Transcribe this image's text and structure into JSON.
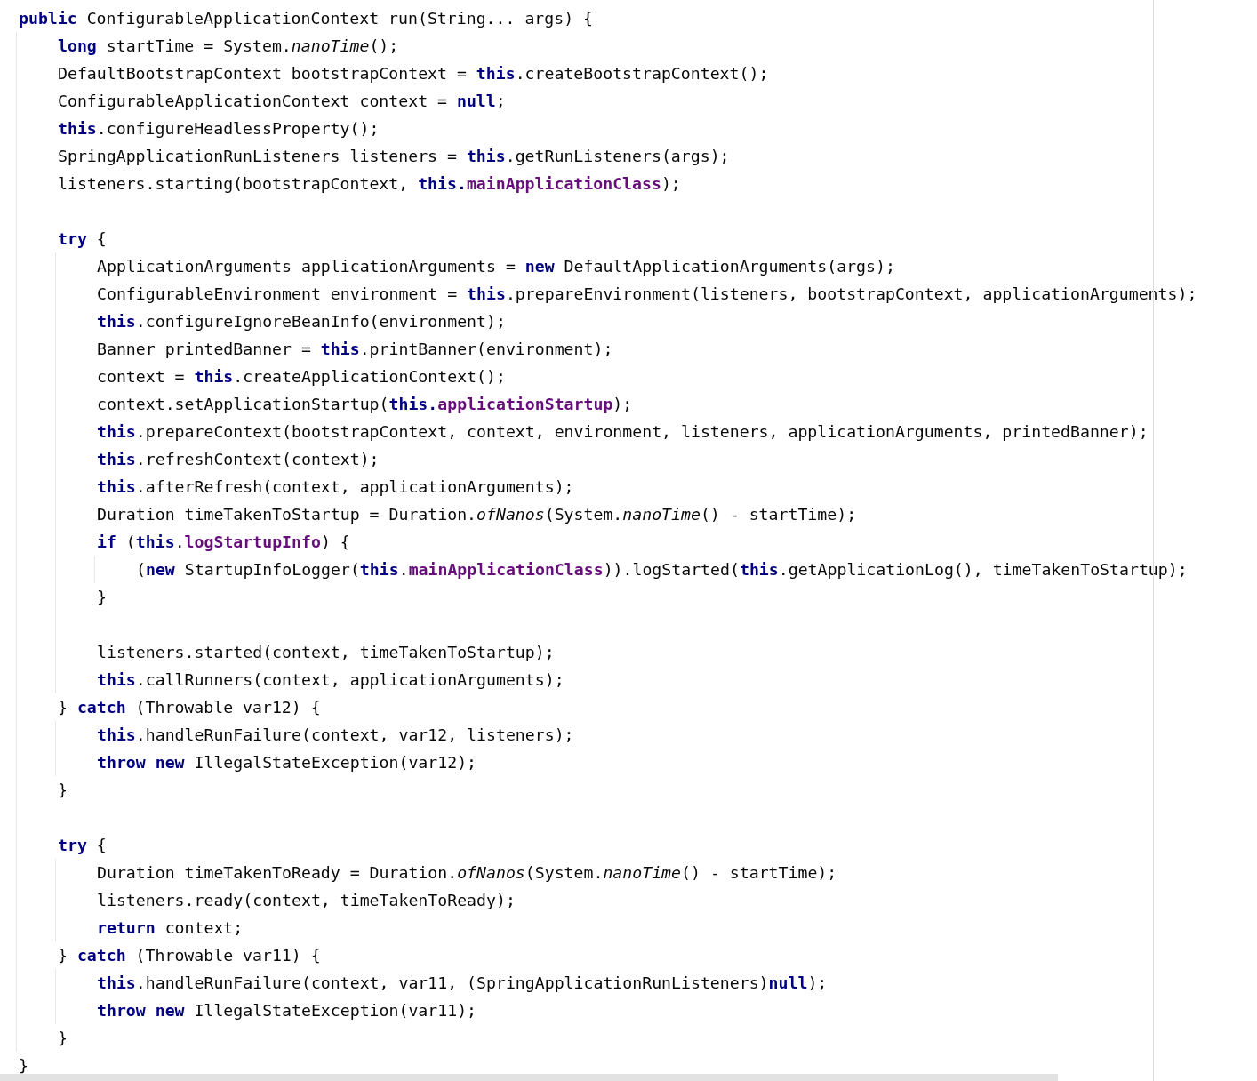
{
  "editor": {
    "lines": [
      {
        "kind": "code",
        "tokens": [
          {
            "kind": "keyword",
            "text": "public"
          },
          {
            "kind": "plain",
            "text": " ConfigurableApplicationContext run(String... args) {"
          }
        ],
        "children": [
          {
            "kind": "code",
            "tokens": [
              {
                "kind": "keyword",
                "text": "long"
              },
              {
                "kind": "plain",
                "text": " startTime = System."
              },
              {
                "kind": "static",
                "text": "nanoTime"
              },
              {
                "kind": "plain",
                "text": "();"
              }
            ]
          },
          {
            "kind": "code",
            "tokens": [
              {
                "kind": "plain",
                "text": "DefaultBootstrapContext bootstrapContext = "
              },
              {
                "kind": "keyword",
                "text": "this"
              },
              {
                "kind": "plain",
                "text": ".createBootstrapContext();"
              }
            ]
          },
          {
            "kind": "code",
            "tokens": [
              {
                "kind": "plain",
                "text": "ConfigurableApplicationContext context = "
              },
              {
                "kind": "keyword",
                "text": "null"
              },
              {
                "kind": "plain",
                "text": ";"
              }
            ]
          },
          {
            "kind": "code",
            "tokens": [
              {
                "kind": "keyword",
                "text": "this"
              },
              {
                "kind": "plain",
                "text": ".configureHeadlessProperty();"
              }
            ]
          },
          {
            "kind": "code",
            "tokens": [
              {
                "kind": "plain",
                "text": "SpringApplicationRunListeners listeners = "
              },
              {
                "kind": "keyword",
                "text": "this"
              },
              {
                "kind": "plain",
                "text": ".getRunListeners(args);"
              }
            ]
          },
          {
            "kind": "code",
            "tokens": [
              {
                "kind": "plain",
                "text": "listeners.starting(bootstrapContext, "
              },
              {
                "kind": "keyword",
                "text": "this."
              },
              {
                "kind": "field",
                "text": "mainApplicationClass"
              },
              {
                "kind": "plain",
                "text": ");"
              }
            ]
          },
          {
            "kind": "blank"
          },
          {
            "kind": "code",
            "tokens": [
              {
                "kind": "keyword",
                "text": "try"
              },
              {
                "kind": "plain",
                "text": " {"
              }
            ],
            "children": [
              {
                "kind": "code",
                "tokens": [
                  {
                    "kind": "plain",
                    "text": "ApplicationArguments applicationArguments = "
                  },
                  {
                    "kind": "keyword",
                    "text": "new"
                  },
                  {
                    "kind": "plain",
                    "text": " DefaultApplicationArguments(args);"
                  }
                ]
              },
              {
                "kind": "code",
                "tokens": [
                  {
                    "kind": "plain",
                    "text": "ConfigurableEnvironment environment = "
                  },
                  {
                    "kind": "keyword",
                    "text": "this"
                  },
                  {
                    "kind": "plain",
                    "text": ".prepareEnvironment(listeners, bootstrapContext, applicationArguments);"
                  }
                ]
              },
              {
                "kind": "code",
                "tokens": [
                  {
                    "kind": "keyword",
                    "text": "this"
                  },
                  {
                    "kind": "plain",
                    "text": ".configureIgnoreBeanInfo(environment);"
                  }
                ]
              },
              {
                "kind": "code",
                "tokens": [
                  {
                    "kind": "plain",
                    "text": "Banner printedBanner = "
                  },
                  {
                    "kind": "keyword",
                    "text": "this"
                  },
                  {
                    "kind": "plain",
                    "text": ".printBanner(environment);"
                  }
                ]
              },
              {
                "kind": "code",
                "tokens": [
                  {
                    "kind": "plain",
                    "text": "context = "
                  },
                  {
                    "kind": "keyword",
                    "text": "this"
                  },
                  {
                    "kind": "plain",
                    "text": ".createApplicationContext();"
                  }
                ]
              },
              {
                "kind": "code",
                "tokens": [
                  {
                    "kind": "plain",
                    "text": "context.setApplicationStartup("
                  },
                  {
                    "kind": "keyword",
                    "text": "this."
                  },
                  {
                    "kind": "field",
                    "text": "applicationStartup"
                  },
                  {
                    "kind": "plain",
                    "text": ");"
                  }
                ]
              },
              {
                "kind": "code",
                "tokens": [
                  {
                    "kind": "keyword",
                    "text": "this"
                  },
                  {
                    "kind": "plain",
                    "text": ".prepareContext(bootstrapContext, context, environment, listeners, applicationArguments, printedBanner);"
                  }
                ]
              },
              {
                "kind": "code",
                "tokens": [
                  {
                    "kind": "keyword",
                    "text": "this"
                  },
                  {
                    "kind": "plain",
                    "text": ".refreshContext(context);"
                  }
                ]
              },
              {
                "kind": "code",
                "tokens": [
                  {
                    "kind": "keyword",
                    "text": "this"
                  },
                  {
                    "kind": "plain",
                    "text": ".afterRefresh(context, applicationArguments);"
                  }
                ]
              },
              {
                "kind": "code",
                "tokens": [
                  {
                    "kind": "plain",
                    "text": "Duration timeTakenToStartup = Duration."
                  },
                  {
                    "kind": "static",
                    "text": "ofNanos"
                  },
                  {
                    "kind": "plain",
                    "text": "(System."
                  },
                  {
                    "kind": "static",
                    "text": "nanoTime"
                  },
                  {
                    "kind": "plain",
                    "text": "() - startTime);"
                  }
                ]
              },
              {
                "kind": "code",
                "tokens": [
                  {
                    "kind": "keyword",
                    "text": "if"
                  },
                  {
                    "kind": "plain",
                    "text": " ("
                  },
                  {
                    "kind": "keyword",
                    "text": "this"
                  },
                  {
                    "kind": "plain",
                    "text": "."
                  },
                  {
                    "kind": "field",
                    "text": "logStartupInfo"
                  },
                  {
                    "kind": "plain",
                    "text": ") {"
                  }
                ],
                "children": [
                  {
                    "kind": "code",
                    "tokens": [
                      {
                        "kind": "plain",
                        "text": "("
                      },
                      {
                        "kind": "keyword",
                        "text": "new"
                      },
                      {
                        "kind": "plain",
                        "text": " StartupInfoLogger("
                      },
                      {
                        "kind": "keyword",
                        "text": "this"
                      },
                      {
                        "kind": "plain",
                        "text": "."
                      },
                      {
                        "kind": "field",
                        "text": "mainApplicationClass"
                      },
                      {
                        "kind": "plain",
                        "text": ")).logStarted("
                      },
                      {
                        "kind": "keyword",
                        "text": "this"
                      },
                      {
                        "kind": "plain",
                        "text": ".getApplicationLog(), timeTakenToStartup);"
                      }
                    ]
                  }
                ]
              },
              {
                "kind": "code",
                "tokens": [
                  {
                    "kind": "plain",
                    "text": "}"
                  }
                ]
              },
              {
                "kind": "blank"
              },
              {
                "kind": "code",
                "tokens": [
                  {
                    "kind": "plain",
                    "text": "listeners.started(context, timeTakenToStartup);"
                  }
                ]
              },
              {
                "kind": "code",
                "tokens": [
                  {
                    "kind": "keyword",
                    "text": "this"
                  },
                  {
                    "kind": "plain",
                    "text": ".callRunners(context, applicationArguments);"
                  }
                ]
              }
            ]
          },
          {
            "kind": "code",
            "tokens": [
              {
                "kind": "plain",
                "text": "} "
              },
              {
                "kind": "keyword",
                "text": "catch"
              },
              {
                "kind": "plain",
                "text": " (Throwable var12) {"
              }
            ],
            "children": [
              {
                "kind": "code",
                "tokens": [
                  {
                    "kind": "keyword",
                    "text": "this"
                  },
                  {
                    "kind": "plain",
                    "text": ".handleRunFailure(context, var12, listeners);"
                  }
                ]
              },
              {
                "kind": "code",
                "tokens": [
                  {
                    "kind": "keyword",
                    "text": "throw new"
                  },
                  {
                    "kind": "plain",
                    "text": " IllegalStateException(var12);"
                  }
                ]
              }
            ]
          },
          {
            "kind": "code",
            "tokens": [
              {
                "kind": "plain",
                "text": "}"
              }
            ]
          },
          {
            "kind": "blank"
          },
          {
            "kind": "code",
            "tokens": [
              {
                "kind": "keyword",
                "text": "try"
              },
              {
                "kind": "plain",
                "text": " {"
              }
            ],
            "children": [
              {
                "kind": "code",
                "tokens": [
                  {
                    "kind": "plain",
                    "text": "Duration timeTakenToReady = Duration."
                  },
                  {
                    "kind": "static",
                    "text": "ofNanos"
                  },
                  {
                    "kind": "plain",
                    "text": "(System."
                  },
                  {
                    "kind": "static",
                    "text": "nanoTime"
                  },
                  {
                    "kind": "plain",
                    "text": "() - startTime);"
                  }
                ]
              },
              {
                "kind": "code",
                "tokens": [
                  {
                    "kind": "plain",
                    "text": "listeners.ready(context, timeTakenToReady);"
                  }
                ]
              },
              {
                "kind": "code",
                "tokens": [
                  {
                    "kind": "keyword",
                    "text": "return"
                  },
                  {
                    "kind": "plain",
                    "text": " context;"
                  }
                ]
              }
            ]
          },
          {
            "kind": "code",
            "tokens": [
              {
                "kind": "plain",
                "text": "} "
              },
              {
                "kind": "keyword",
                "text": "catch"
              },
              {
                "kind": "plain",
                "text": " (Throwable var11) {"
              }
            ],
            "children": [
              {
                "kind": "code",
                "tokens": [
                  {
                    "kind": "keyword",
                    "text": "this"
                  },
                  {
                    "kind": "plain",
                    "text": ".handleRunFailure(context, var11, (SpringApplicationRunListeners)"
                  },
                  {
                    "kind": "keyword",
                    "text": "null"
                  },
                  {
                    "kind": "plain",
                    "text": ");"
                  }
                ]
              },
              {
                "kind": "code",
                "tokens": [
                  {
                    "kind": "keyword",
                    "text": "throw new"
                  },
                  {
                    "kind": "plain",
                    "text": " IllegalStateException(var11);"
                  }
                ]
              }
            ]
          },
          {
            "kind": "code",
            "tokens": [
              {
                "kind": "plain",
                "text": "}"
              }
            ]
          }
        ]
      },
      {
        "kind": "code",
        "tokens": [
          {
            "kind": "plain",
            "text": "}"
          }
        ]
      }
    ]
  }
}
